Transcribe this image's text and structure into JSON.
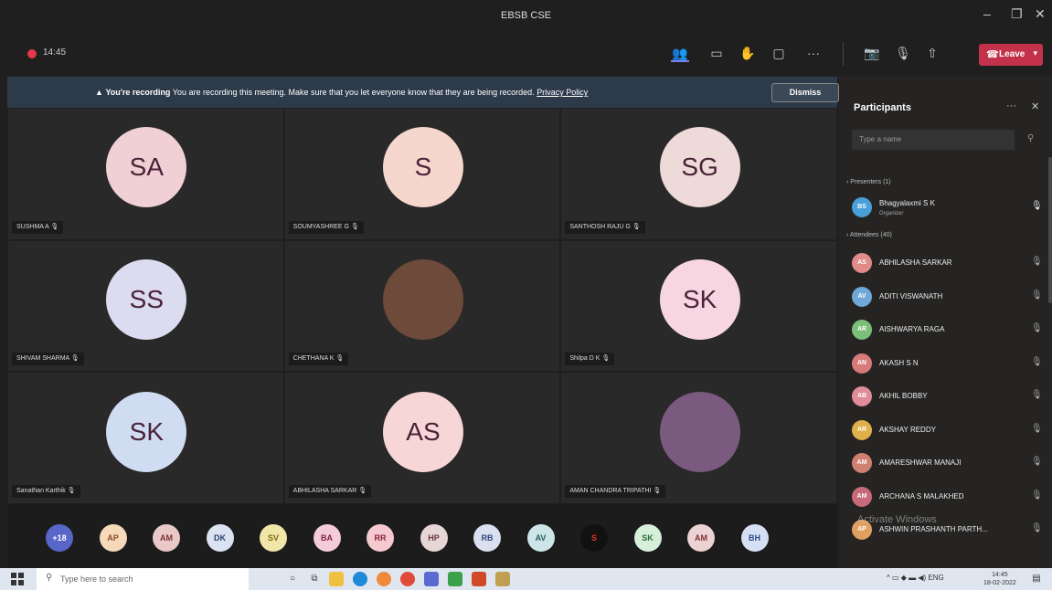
{
  "window": {
    "title": "EBSB CSE"
  },
  "toolbar": {
    "timer": "14:45",
    "leave_label": "Leave"
  },
  "banner": {
    "bold": "You're recording",
    "text": "You are recording this meeting. Make sure that you let everyone know that they are being recorded.",
    "link": "Privacy Policy",
    "dismiss_label": "Dismiss"
  },
  "tiles": [
    {
      "initials": "SA",
      "name": "SUSHMA A",
      "bg": "#f0d0d4"
    },
    {
      "initials": "S",
      "name": "SOUMYASHREE G",
      "bg": "#f5d7cd"
    },
    {
      "initials": "SG",
      "name": "SANTHOSH RAJU G",
      "bg": "#eedad8"
    },
    {
      "initials": "SS",
      "name": "SHIVAM SHARMA",
      "bg": "#dcdcf0"
    },
    {
      "initials": "",
      "name": "CHETHANA K",
      "bg": "#6e4a3a"
    },
    {
      "initials": "SK",
      "name": "Shilpa D K",
      "bg": "#f7d6e2"
    },
    {
      "initials": "SK",
      "name": "Sanathan Karthik",
      "bg": "#cfdcf2"
    },
    {
      "initials": "AS",
      "name": "ABHILASHA SARKAR",
      "bg": "#f7d6d8"
    },
    {
      "initials": "",
      "name": "AMAN CHANDRA TRIPATHI",
      "bg": "#7a5a7e"
    }
  ],
  "strip": [
    {
      "initials": "+18",
      "bg": "#5865c9",
      "fg": "#ffffff"
    },
    {
      "initials": "AP",
      "bg": "#f6d9b8",
      "fg": "#8a4a22"
    },
    {
      "initials": "AM",
      "bg": "#e9c8c8",
      "fg": "#7a3232"
    },
    {
      "initials": "DK",
      "bg": "#dbe2f1",
      "fg": "#2b3f6e"
    },
    {
      "initials": "SV",
      "bg": "#f0e6a8",
      "fg": "#7a6a12"
    },
    {
      "initials": "BA",
      "bg": "#f4cbd9",
      "fg": "#7a2448"
    },
    {
      "initials": "RR",
      "bg": "#f6c9d1",
      "fg": "#8a2436"
    },
    {
      "initials": "HP",
      "bg": "#e6d6d6",
      "fg": "#6e3a3a"
    },
    {
      "initials": "RB",
      "bg": "#dbe0f0",
      "fg": "#334a7a"
    },
    {
      "initials": "AV",
      "bg": "#cde4e8",
      "fg": "#2a5e66"
    },
    {
      "initials": "S",
      "bg": "#111111",
      "fg": "#e63030"
    },
    {
      "initials": "SK",
      "bg": "#d6efd8",
      "fg": "#2e6e36"
    },
    {
      "initials": "AM",
      "bg": "#ecd2d2",
      "fg": "#7a3232"
    },
    {
      "initials": "BH",
      "bg": "#d6e0f4",
      "fg": "#2b4a8a"
    }
  ],
  "panel": {
    "title": "Participants",
    "search_placeholder": "Type a name",
    "presenters_label": "Presenters (1)",
    "organizer": {
      "initials": "BS",
      "name": "Bhagyalaxmi S K",
      "role": "Organizer",
      "bg": "#4aa0d8"
    },
    "attendees_label": "Attendees (40)",
    "attendees": [
      {
        "initials": "AS",
        "name": "ABHILASHA SARKAR",
        "bg": "#e08a8a"
      },
      {
        "initials": "AV",
        "name": "ADITI VISWANATH",
        "bg": "#6fa8d6"
      },
      {
        "initials": "AR",
        "name": "AISHWARYA RAGA",
        "bg": "#7bbf7b"
      },
      {
        "initials": "AN",
        "name": "AKASH S N",
        "bg": "#d97a7a"
      },
      {
        "initials": "AB",
        "name": "AKHIL BOBBY",
        "bg": "#e08c9a"
      },
      {
        "initials": "AR",
        "name": "AKSHAY REDDY",
        "bg": "#e0b04a"
      },
      {
        "initials": "AM",
        "name": "AMARESHWAR MANAJI",
        "bg": "#d08070"
      },
      {
        "initials": "AM",
        "name": "ARCHANA S MALAKHED",
        "bg": "#c86a7a"
      },
      {
        "initials": "AP",
        "name": "ASHWIN PRASHANTH PARTH...",
        "bg": "#e0a060"
      }
    ],
    "watermark": "Activate Windows"
  },
  "taskbar": {
    "search_placeholder": "Type here to search",
    "lang": "ENG",
    "time": "14:45",
    "date": "18-02-2022"
  }
}
